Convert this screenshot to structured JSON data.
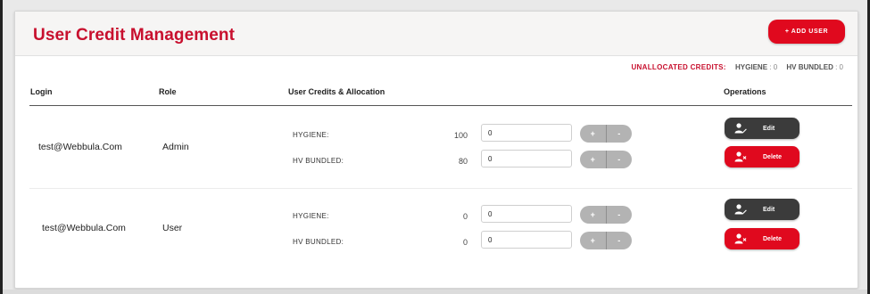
{
  "page": {
    "title": "User Credit Management",
    "add_user_label": "+ ADD USER"
  },
  "summary": {
    "unallocated_label": "UNALLOCATED CREDITS:",
    "hygiene_label": "HYGIENE",
    "hygiene_value": ": 0",
    "hv_bundled_label": "HV BUNDLED",
    "hv_bundled_value": ": 0"
  },
  "table": {
    "headers": {
      "login": "Login",
      "role": "Role",
      "credits": "User Credits & Allocation",
      "operations": "Operations"
    },
    "rows": [
      {
        "login": "test@Webbula.Com",
        "role": "Admin",
        "allocations": [
          {
            "label": "HYGIENE:",
            "credits": "100",
            "input_value": "0"
          },
          {
            "label": "HV BUNDLED:",
            "credits": "80",
            "input_value": "0"
          }
        ],
        "edit_label": "Edit",
        "delete_label": "Delete"
      },
      {
        "login": "test@Webbula.Com",
        "role": "User",
        "allocations": [
          {
            "label": "HYGIENE:",
            "credits": "0",
            "input_value": "0"
          },
          {
            "label": "HV BUNDLED:",
            "credits": "0",
            "input_value": "0"
          }
        ],
        "edit_label": "Edit",
        "delete_label": "Delete"
      }
    ],
    "stepper": {
      "plus": "+",
      "minus": "-"
    }
  },
  "colors": {
    "brand_red": "#c8102e",
    "button_red": "#e0091e",
    "edit_dark": "#3b3b3b",
    "stepper_gray": "#b3b3b3"
  },
  "icons": {
    "edit": "user-edit-icon",
    "delete": "user-remove-icon"
  }
}
